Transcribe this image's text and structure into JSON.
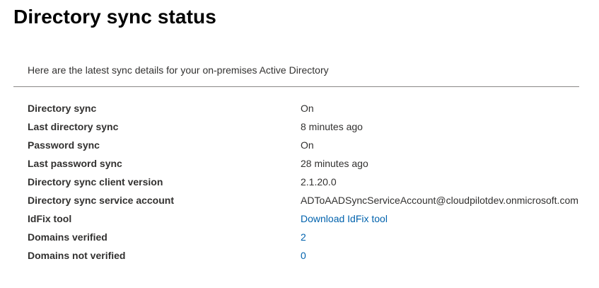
{
  "page": {
    "title": "Directory sync status",
    "intro": "Here are the latest sync details for your on-premises Active Directory"
  },
  "details": [
    {
      "label": "Directory sync",
      "value": "On"
    },
    {
      "label": "Last directory sync",
      "value": "8 minutes ago"
    },
    {
      "label": "Password sync",
      "value": "On"
    },
    {
      "label": "Last password sync",
      "value": "28 minutes ago"
    },
    {
      "label": "Directory sync client version",
      "value": "2.1.20.0"
    },
    {
      "label": "Directory sync service account",
      "value": "ADToAADSyncServiceAccount@cloudpilotdev.onmicrosoft.com"
    },
    {
      "label": "IdFix tool",
      "value": "Download IdFix tool"
    },
    {
      "label": "Domains verified",
      "value": "2"
    },
    {
      "label": "Domains not verified",
      "value": "0"
    }
  ],
  "colors": {
    "link": "#0062ad",
    "text": "#323130",
    "divider": "#8a8886"
  }
}
